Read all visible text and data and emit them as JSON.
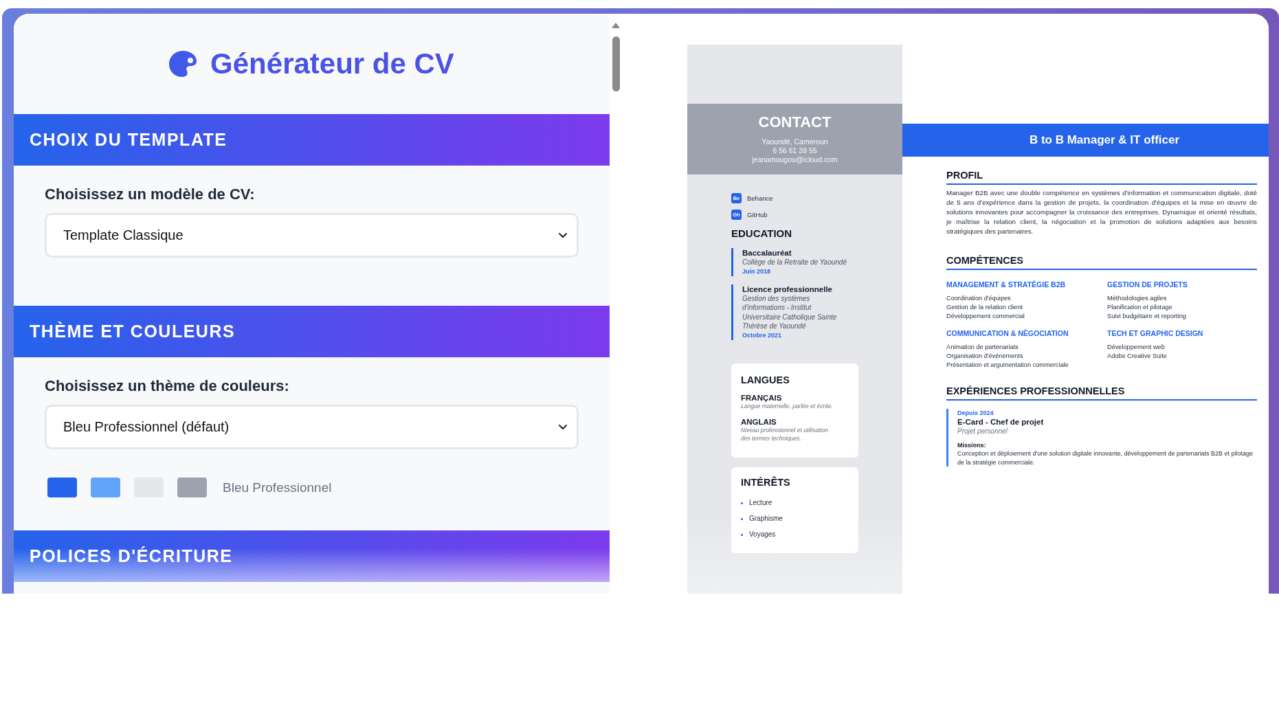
{
  "app": {
    "title": "Générateur de CV"
  },
  "sections": [
    {
      "title": "CHOIX DU TEMPLATE",
      "label": "Choisissez un modèle de CV:",
      "value": "Template Classique"
    },
    {
      "title": "THÈME ET COULEURS",
      "label": "Choisissez un thème de couleurs:",
      "value": "Bleu Professionnel (défaut)",
      "swatches": [
        {
          "color": "#2563eb"
        },
        {
          "color": "#60a5fa"
        },
        {
          "color": "#e5e7eb"
        },
        {
          "color": "#9ca3af"
        }
      ],
      "swatch_label": "Bleu Professionnel"
    },
    {
      "title": "POLICES D'ÉCRITURE"
    }
  ],
  "cv": {
    "contact": {
      "title": "CONTACT",
      "lines": [
        "Yaoundé, Cameroun",
        "6 56 61 39 55",
        "jeanamougou@icloud.com"
      ]
    },
    "links": [
      {
        "badge": "Be",
        "label": "Behance"
      },
      {
        "badge": "Gh",
        "label": "GitHub"
      }
    ],
    "education": {
      "title": "EDUCATION",
      "items": [
        {
          "degree": "Baccalauréat",
          "school": "Collège de la Retraite de Yaoundé",
          "date": "Juin 2018"
        },
        {
          "degree": "Licence professionnelle",
          "school": "Gestion des systèmes d'informations - Institut Universitaire Catholique Sainte Thérèse de Yaoundé",
          "date": "Octobre 2021"
        }
      ]
    },
    "languages": {
      "title": "LANGUES",
      "items": [
        {
          "name": "FRANÇAIS",
          "description": "Langue maternelle, parlée et écrite."
        },
        {
          "name": "ANGLAIS",
          "description": "Niveau professionnel et utilisation des termes techniques."
        }
      ]
    },
    "interests": {
      "title": "INTÉRÊTS",
      "items": [
        "Lecture",
        "Graphisme",
        "Voyages"
      ]
    },
    "headline": "B to B Manager & IT officer",
    "profile": {
      "title": "PROFIL",
      "text": "Manager B2B avec une double compétence en systèmes d'information et communication digitale, doté de 5 ans d'expérience dans la gestion de projets, la coordination d'équipes et la mise en œuvre de solutions innovantes pour accompagner la croissance des entreprises. Dynamique et orienté résultats, je maîtrise la relation client, la négociation et la promotion de solutions adaptées aux besoins stratégiques des partenaires."
    },
    "skills": {
      "title": "COMPÉTENCES",
      "groups": [
        {
          "title": "MANAGEMENT & STRATÉGIE B2B",
          "items": [
            "Coordination d'équipes",
            "Gestion de la relation client",
            "Développement commercial"
          ]
        },
        {
          "title": "GESTION DE PROJETS",
          "items": [
            "Méthodologies agiles",
            "Planification et pilotage",
            "Suivi budgétaire et reporting"
          ]
        },
        {
          "title": "COMMUNICATION & NÉGOCIATION",
          "items": [
            "Animation de partenariats",
            "Organisation d'événements",
            "Présentation et argumentation commerciale"
          ]
        },
        {
          "title": "TECH ET GRAPHIC DESIGN",
          "items": [
            "Développement web",
            "Adobe Creative Suite"
          ]
        }
      ]
    },
    "experience": {
      "title": "EXPÉRIENCES PROFESSIONNELLES",
      "items": [
        {
          "period": "Depuis 2024",
          "role": "E-Card - Chef de projet",
          "context": "Projet personnel",
          "missions_label": "Missions:",
          "missions": "Conception et déploiement d'une solution digitale innovante, développement de partenariats B2B et pilotage de la stratégie commerciale."
        }
      ]
    }
  }
}
